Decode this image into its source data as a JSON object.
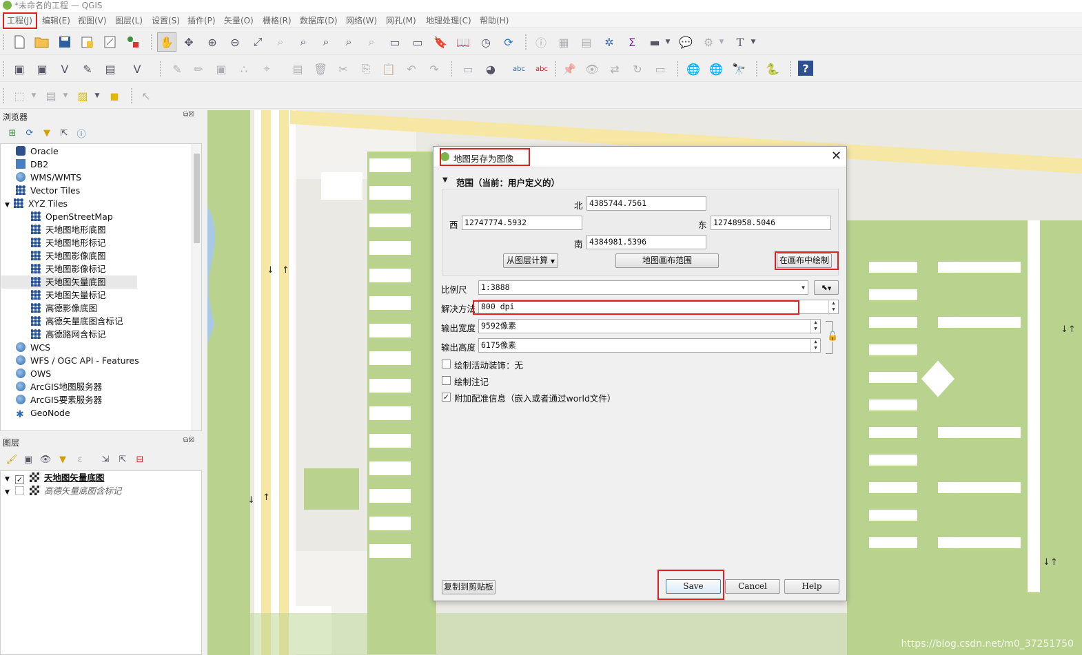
{
  "window": {
    "title": "*未命名的工程 — QGIS"
  },
  "menu": [
    "工程(J)",
    "编辑(E)",
    "视图(V)",
    "图层(L)",
    "设置(S)",
    "插件(P)",
    "矢量(O)",
    "栅格(R)",
    "数据库(D)",
    "网络(W)",
    "网孔(M)",
    "地理处理(C)",
    "帮助(H)"
  ],
  "browser_panel": {
    "title": "浏览器",
    "items": [
      {
        "label": "Oracle",
        "icon": "oracle-icon"
      },
      {
        "label": "DB2",
        "icon": "db2-icon"
      },
      {
        "label": "WMS/WMTS",
        "icon": "globe-icon"
      },
      {
        "label": "Vector Tiles",
        "icon": "grid-icon"
      },
      {
        "label": "XYZ Tiles",
        "icon": "grid-icon",
        "expanded": true
      },
      {
        "label": "OpenStreetMap",
        "icon": "grid-icon",
        "child": true
      },
      {
        "label": "天地图地形底图",
        "icon": "grid-icon",
        "child": true
      },
      {
        "label": "天地图地形标记",
        "icon": "grid-icon",
        "child": true
      },
      {
        "label": "天地图影像底图",
        "icon": "grid-icon",
        "child": true
      },
      {
        "label": "天地图影像标记",
        "icon": "grid-icon",
        "child": true
      },
      {
        "label": "天地图矢量底图",
        "icon": "grid-icon",
        "child": true,
        "selected": true
      },
      {
        "label": "天地图矢量标记",
        "icon": "grid-icon",
        "child": true
      },
      {
        "label": "高德影像底图",
        "icon": "grid-icon",
        "child": true
      },
      {
        "label": "高德矢量底图含标记",
        "icon": "grid-icon",
        "child": true
      },
      {
        "label": "高德路网含标记",
        "icon": "grid-icon",
        "child": true
      },
      {
        "label": "WCS",
        "icon": "globe-icon"
      },
      {
        "label": "WFS / OGC API - Features",
        "icon": "globe-icon"
      },
      {
        "label": "OWS",
        "icon": "globe-icon"
      },
      {
        "label": "ArcGIS地图服务器",
        "icon": "globe-icon"
      },
      {
        "label": "ArcGIS要素服务器",
        "icon": "globe-icon"
      },
      {
        "label": "GeoNode",
        "icon": "geonode-icon"
      }
    ]
  },
  "layers_panel": {
    "title": "图层",
    "items": [
      {
        "label": "天地图矢量底图",
        "checked": true
      },
      {
        "label": "高德矢量底图含标记",
        "checked": false
      }
    ]
  },
  "dialog": {
    "title": "地图另存为图像",
    "extent_header": "范围（当前：用户定义的）",
    "north_label": "北",
    "north": "4385744.7561",
    "west_label": "西",
    "west": "12747774.5932",
    "east_label": "东",
    "east": "12748958.5046",
    "south_label": "南",
    "south": "4384981.5396",
    "calc_from_layer": "从图层计算",
    "layout_extent": "地图画布范围",
    "draw_on_canvas": "在画布中绘制",
    "scale_label": "比例尺",
    "scale": "1:3888",
    "resolution_label": "解决方法",
    "resolution": "800 dpi",
    "width_label": "输出宽度",
    "width": "9592像素",
    "height_label": "输出高度",
    "height": "6175像素",
    "opt_decorations": "绘制活动装饰：无",
    "opt_decorations_checked": false,
    "opt_annotations": "绘制注记",
    "opt_annotations_checked": false,
    "opt_georef": "附加配准信息（嵌入或者通过world文件）",
    "opt_georef_checked": true,
    "copy_clipboard": "复制到剪贴板",
    "save": "Save",
    "cancel": "Cancel",
    "help": "Help"
  },
  "watermark": "https://blog.csdn.net/m0_37251750",
  "colors": {
    "highlight": "#e02020",
    "map_green": "#b7d48d",
    "map_road": "#f7e7a5"
  }
}
